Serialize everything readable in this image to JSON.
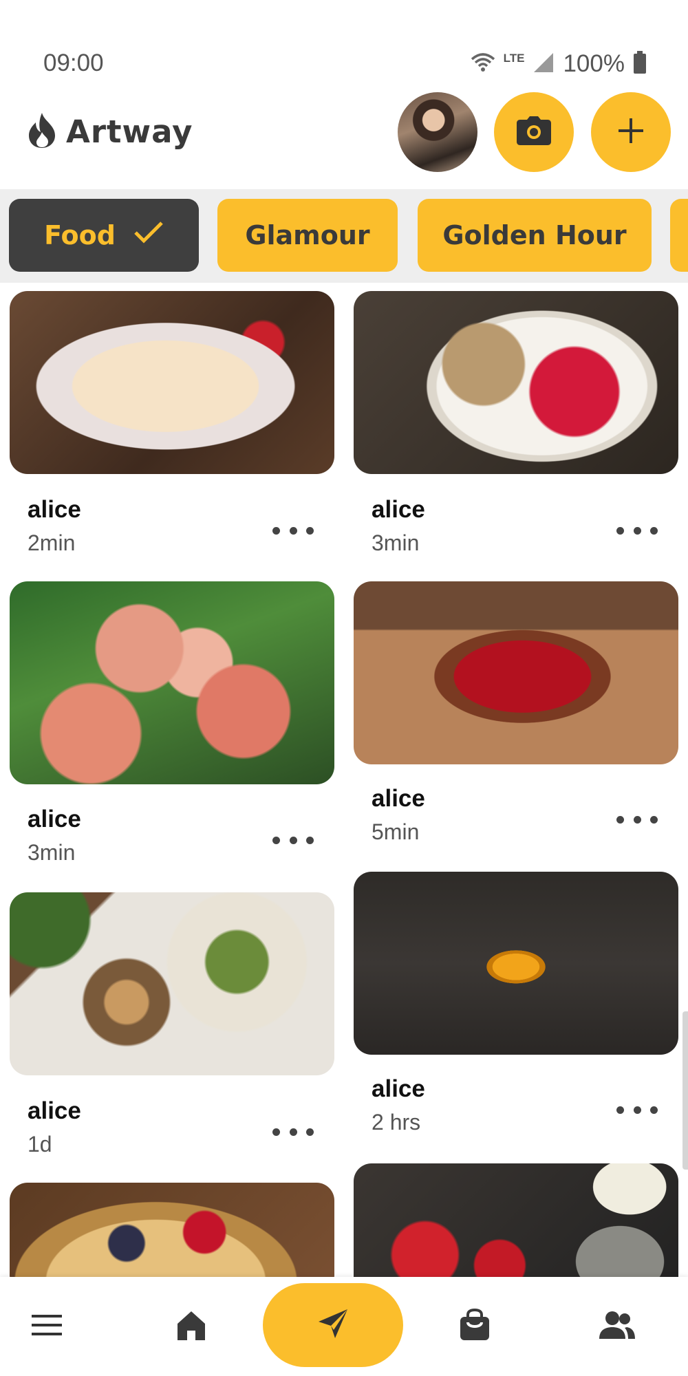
{
  "status_bar": {
    "time": "09:00",
    "network": "LTE",
    "battery": "100%",
    "icons": [
      "wifi-icon",
      "cell-signal-icon",
      "battery-icon"
    ]
  },
  "app": {
    "name": "Artway",
    "logo_icon": "flame-icon",
    "accent_color": "#fbbe2c",
    "dark_color": "#3f3f3f"
  },
  "header_actions": {
    "avatar": "user-avatar",
    "camera_icon": "camera-icon",
    "add_icon": "plus-icon"
  },
  "categories": [
    {
      "label": "Food",
      "selected": true
    },
    {
      "label": "Glamour",
      "selected": false
    },
    {
      "label": "Golden Hour",
      "selected": false
    },
    {
      "label": "",
      "selected": false
    }
  ],
  "feed": {
    "posts": [
      {
        "author": "alice",
        "time": "2min",
        "photo": "strawberry crepes"
      },
      {
        "author": "alice",
        "time": "3min",
        "photo": "yogurt bowl with raspberries"
      },
      {
        "author": "alice",
        "time": "3min",
        "photo": "peaches on branch"
      },
      {
        "author": "alice",
        "time": "5min",
        "photo": "cherries on plate"
      },
      {
        "author": "alice",
        "time": "1d",
        "photo": "coffee and sandwich"
      },
      {
        "author": "alice",
        "time": "2 hrs",
        "photo": "pumpkin on wood"
      },
      {
        "author": "",
        "time": "",
        "photo": "berry tart"
      },
      {
        "author": "",
        "time": "",
        "photo": "berries and flowers"
      }
    ],
    "more_icon": "more-horizontal-icon"
  },
  "bottom_nav": {
    "items": [
      "menu-icon",
      "home-icon",
      "send-icon",
      "shopping-bag-icon",
      "people-icon"
    ],
    "active": "send-icon"
  }
}
